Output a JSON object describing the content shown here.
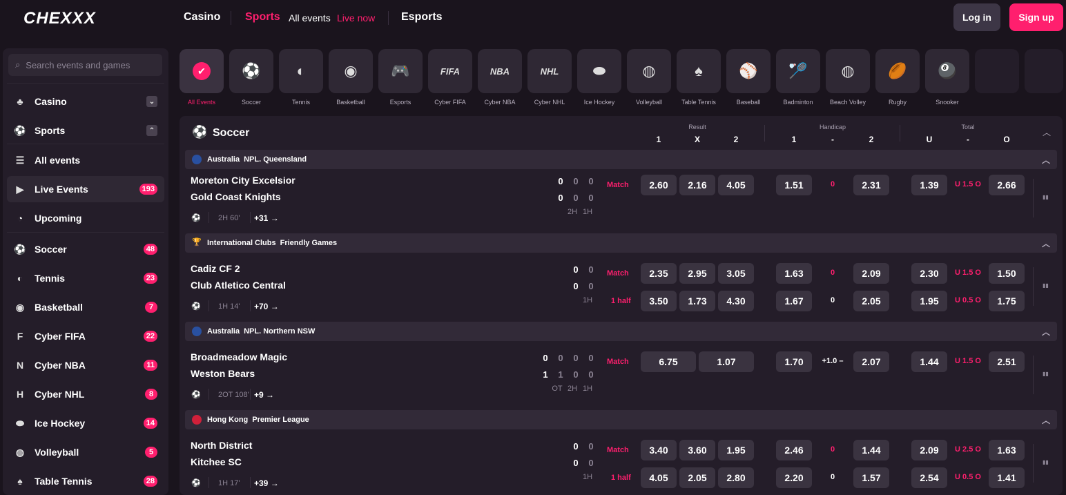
{
  "header": {
    "logo": "CHEXXX",
    "nav": [
      "Casino",
      "Sports",
      "All events",
      "Live now",
      "Esports"
    ],
    "login": "Log in",
    "signup": "Sign up"
  },
  "sidebar": {
    "search_placeholder": "Search events and games",
    "items": [
      {
        "label": "Casino",
        "icon": "cherries-icon"
      },
      {
        "label": "Sports",
        "icon": "soccer-ball-icon"
      },
      {
        "label": "All events",
        "icon": "list-icon"
      },
      {
        "label": "Live Events",
        "icon": "play-icon",
        "count": "193"
      },
      {
        "label": "Upcoming",
        "icon": "clock-icon"
      },
      {
        "label": "Soccer",
        "icon": "soccer-ball-icon",
        "count": "48"
      },
      {
        "label": "Tennis",
        "icon": "tennis-ball-icon",
        "count": "23"
      },
      {
        "label": "Basketball",
        "icon": "basketball-icon",
        "count": "7"
      },
      {
        "label": "Cyber FIFA",
        "icon": "fifa-icon",
        "count": "22"
      },
      {
        "label": "Cyber NBA",
        "icon": "nba-icon",
        "count": "11"
      },
      {
        "label": "Cyber NHL",
        "icon": "nhl-icon",
        "count": "8"
      },
      {
        "label": "Ice Hockey",
        "icon": "puck-icon",
        "count": "14"
      },
      {
        "label": "Volleyball",
        "icon": "volleyball-icon",
        "count": "5"
      },
      {
        "label": "Table Tennis",
        "icon": "paddle-icon",
        "count": "28"
      }
    ]
  },
  "categories": [
    "All Events",
    "Soccer",
    "Tennis",
    "Basketball",
    "Esports",
    "Cyber FIFA",
    "Cyber NBA",
    "Cyber NHL",
    "Ice Hockey",
    "Volleyball",
    "Table Tennis",
    "Baseball",
    "Badminton",
    "Beach Volley",
    "Rugby",
    "Snooker"
  ],
  "cat_glyphs": [
    "FIFA",
    "NBA",
    "NHL"
  ],
  "panel": {
    "title": "Soccer",
    "groups": [
      "Result",
      "Handicap",
      "Total"
    ],
    "sub": [
      "1",
      "X",
      "2",
      "1",
      "-",
      "2",
      "U",
      "-",
      "O"
    ]
  },
  "leagues": [
    {
      "country": "Australia",
      "name": "NPL. Queensland"
    },
    {
      "country": "International Clubs",
      "name": "Friendly Games"
    },
    {
      "country": "Australia",
      "name": "NPL. Northern NSW"
    },
    {
      "country": "Hong Kong",
      "name": "Premier League"
    }
  ],
  "matches": [
    {
      "home": "Moreton City Excelsior",
      "away": "Gold Coast Knights",
      "home_sc": [
        "0",
        "0",
        "0"
      ],
      "away_sc": [
        "0",
        "0",
        "0"
      ],
      "periods": [
        "2H",
        "1H"
      ],
      "time": "2H 60'",
      "more": "+31 →",
      "rows": [
        {
          "label": "Match",
          "res": [
            "2.60",
            "2.16",
            "4.05"
          ],
          "h1": "1.51",
          "hmid": "0",
          "h2": "2.31",
          "u": "1.39",
          "tmid": "U 1.5 O",
          "o": "2.66"
        }
      ]
    },
    {
      "home": "Cadiz CF 2",
      "away": "Club Atletico Central",
      "home_sc": [
        "0",
        "0"
      ],
      "away_sc": [
        "0",
        "0"
      ],
      "periods": [
        "1H"
      ],
      "time": "1H 14'",
      "more": "+70 →",
      "rows": [
        {
          "label": "Match",
          "res": [
            "2.35",
            "2.95",
            "3.05"
          ],
          "h1": "1.63",
          "hmid": "0",
          "h2": "2.09",
          "u": "2.30",
          "tmid": "U 1.5 O",
          "o": "1.50"
        },
        {
          "label": "1 half",
          "res": [
            "3.50",
            "1.73",
            "4.30"
          ],
          "h1": "1.67",
          "hmid": "0",
          "h2": "2.05",
          "u": "1.95",
          "tmid": "U 0.5 O",
          "o": "1.75"
        }
      ]
    },
    {
      "home": "Broadmeadow Magic",
      "away": "Weston Bears",
      "home_sc": [
        "0",
        "0",
        "0",
        "0"
      ],
      "away_sc": [
        "1",
        "1",
        "0",
        "0"
      ],
      "periods": [
        "OT",
        "2H",
        "1H"
      ],
      "time": "2OT 108'",
      "more": "+9 →",
      "rows": [
        {
          "label": "Match",
          "res": [
            "6.75",
            "1.07"
          ],
          "h1": "1.70",
          "hmid": "+1.0 –",
          "h2": "2.07",
          "u": "1.44",
          "tmid": "U 1.5 O",
          "o": "2.51"
        }
      ]
    },
    {
      "home": "North District",
      "away": "Kitchee SC",
      "home_sc": [
        "0",
        "0"
      ],
      "away_sc": [
        "0",
        "0"
      ],
      "periods": [
        "1H"
      ],
      "time": "1H 17'",
      "more": "+39 →",
      "rows": [
        {
          "label": "Match",
          "res": [
            "3.40",
            "3.60",
            "1.95"
          ],
          "h1": "2.46",
          "hmid": "0",
          "h2": "1.44",
          "u": "2.09",
          "tmid": "U 2.5 O",
          "o": "1.63"
        },
        {
          "label": "1 half",
          "res": [
            "4.05",
            "2.05",
            "2.80"
          ],
          "h1": "2.20",
          "hmid": "0",
          "h2": "1.57",
          "u": "2.54",
          "tmid": "U 0.5 O",
          "o": "1.41"
        }
      ]
    }
  ],
  "colors": {
    "accent": "#ff1f6e",
    "bg": "#1a141d",
    "panel": "#241d29",
    "odd": "#3a3340"
  }
}
